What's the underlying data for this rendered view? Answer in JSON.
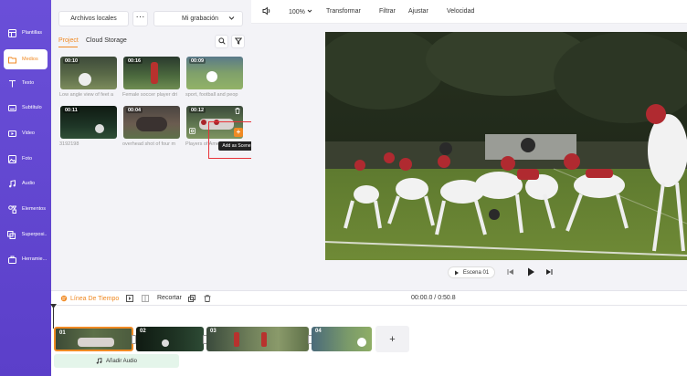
{
  "sidebar": {
    "items": [
      {
        "label": "Plantillas",
        "icon": "template-icon"
      },
      {
        "label": "Medios",
        "icon": "folder-icon",
        "active": true
      },
      {
        "label": "Texto",
        "icon": "text-icon"
      },
      {
        "label": "Subtítulo",
        "icon": "subtitle-icon"
      },
      {
        "label": "Video",
        "icon": "video-icon"
      },
      {
        "label": "Foto",
        "icon": "photo-icon"
      },
      {
        "label": "Audio",
        "icon": "music-icon"
      },
      {
        "label": "Elementos",
        "icon": "elements-icon"
      },
      {
        "label": "Superposi...",
        "icon": "overlay-icon"
      },
      {
        "label": "Herramie...",
        "icon": "toolbox-icon"
      }
    ]
  },
  "media": {
    "local_files": "Archivos locales",
    "more": "···",
    "recording": "Mi grabación",
    "tabs": [
      "Project",
      "Cloud Storage"
    ],
    "items": [
      {
        "duration": "00:10",
        "caption": "Low angle view of feet a"
      },
      {
        "duration": "00:16",
        "caption": "Female soccer player dri"
      },
      {
        "duration": "00:09",
        "caption": "sport, football and peop"
      },
      {
        "duration": "00:11",
        "caption": "3192198"
      },
      {
        "duration": "00:04",
        "caption": "overhead shot of four m"
      },
      {
        "duration": "00:12",
        "caption": "Players of American foot"
      }
    ],
    "tooltip": "Add as Scene",
    "add_symbol": "+"
  },
  "toolbar": {
    "zoom": "100%",
    "transform": "Transformar",
    "filter": "Filtrar",
    "adjust": "Ajustar",
    "speed": "Velocidad"
  },
  "preview": {
    "scene_label": "Escena 01"
  },
  "timeline": {
    "tab": "Línea De Tiempo",
    "trim": "Recortar",
    "time": "00:00.0 / 0:50.8",
    "clips": [
      "01",
      "02",
      "03",
      "04"
    ],
    "add_clip": "+",
    "add_audio": "Añadir Audio"
  },
  "colors": {
    "accent": "#f08a24",
    "sidebar": "#6a4fd8",
    "highlight": "#e8333a"
  }
}
